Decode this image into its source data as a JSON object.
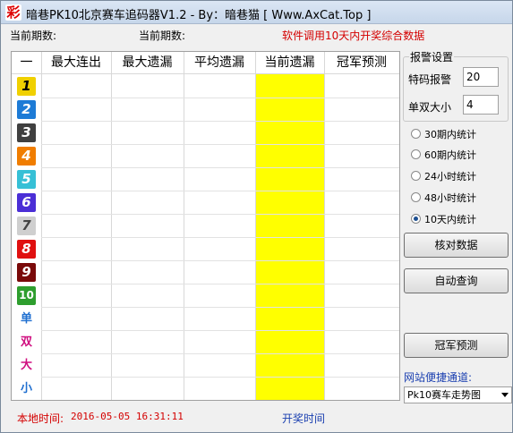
{
  "window": {
    "title": "暗巷PK10北京赛车追码器V1.2 - By：暗巷猫 [ Www.AxCat.Top ]",
    "icon_char": "彩"
  },
  "header": {
    "current_period_label_1": "当前期数:",
    "current_period_label_2": "当前期数:",
    "notice": "软件调用10天内开奖综合数据"
  },
  "table": {
    "columns": [
      "一",
      "最大连出",
      "最大遗漏",
      "平均遗漏",
      "当前遗漏",
      "冠军预测"
    ],
    "rows": [
      {
        "label": "1",
        "color": "#f0d000",
        "text_color": "#000000"
      },
      {
        "label": "2",
        "color": "#1d7bd6",
        "text_color": "#ffffff"
      },
      {
        "label": "3",
        "color": "#404040",
        "text_color": "#ffffff"
      },
      {
        "label": "4",
        "color": "#f07d00",
        "text_color": "#ffffff"
      },
      {
        "label": "5",
        "color": "#36c0d6",
        "text_color": "#ffffff"
      },
      {
        "label": "6",
        "color": "#4b2fd6",
        "text_color": "#ffffff"
      },
      {
        "label": "7",
        "color": "#cfcfcf",
        "text_color": "#444444"
      },
      {
        "label": "8",
        "color": "#e01010",
        "text_color": "#ffffff"
      },
      {
        "label": "9",
        "color": "#7a0a0a",
        "text_color": "#ffffff"
      },
      {
        "label": "10",
        "color": "#2e9e2e",
        "text_color": "#ffffff"
      },
      {
        "label": "单",
        "color": "#ffffff",
        "text_color": "#1f6fd0"
      },
      {
        "label": "双",
        "color": "#ffffff",
        "text_color": "#d01080"
      },
      {
        "label": "大",
        "color": "#ffffff",
        "text_color": "#d01080"
      },
      {
        "label": "小",
        "color": "#ffffff",
        "text_color": "#1f6fd0"
      }
    ],
    "highlight_color": "#ffff00"
  },
  "alarm": {
    "group_label": "报警设置",
    "code_alarm_label": "特码报警",
    "code_alarm_value": "20",
    "odd_even_label": "单双大小",
    "odd_even_value": "4"
  },
  "stats_options": [
    {
      "label": "30期内统计",
      "checked": false
    },
    {
      "label": "60期内统计",
      "checked": false
    },
    {
      "label": "24小时统计",
      "checked": false
    },
    {
      "label": "48小时统计",
      "checked": false
    },
    {
      "label": "10天内统计",
      "checked": true
    }
  ],
  "buttons": {
    "verify": "核对数据",
    "auto_query": "自动查询",
    "champion_predict": "冠军预测"
  },
  "shortcut": {
    "label": "网站便捷通道:",
    "selected": "Pk10赛车走势图"
  },
  "footer": {
    "local_time_label": "本地时间:",
    "local_time_value": "2016-05-05 16:31:11",
    "draw_time_label": "开奖时间"
  },
  "colors": {
    "accent_red": "#d40000",
    "accent_blue": "#1a3fb0"
  }
}
